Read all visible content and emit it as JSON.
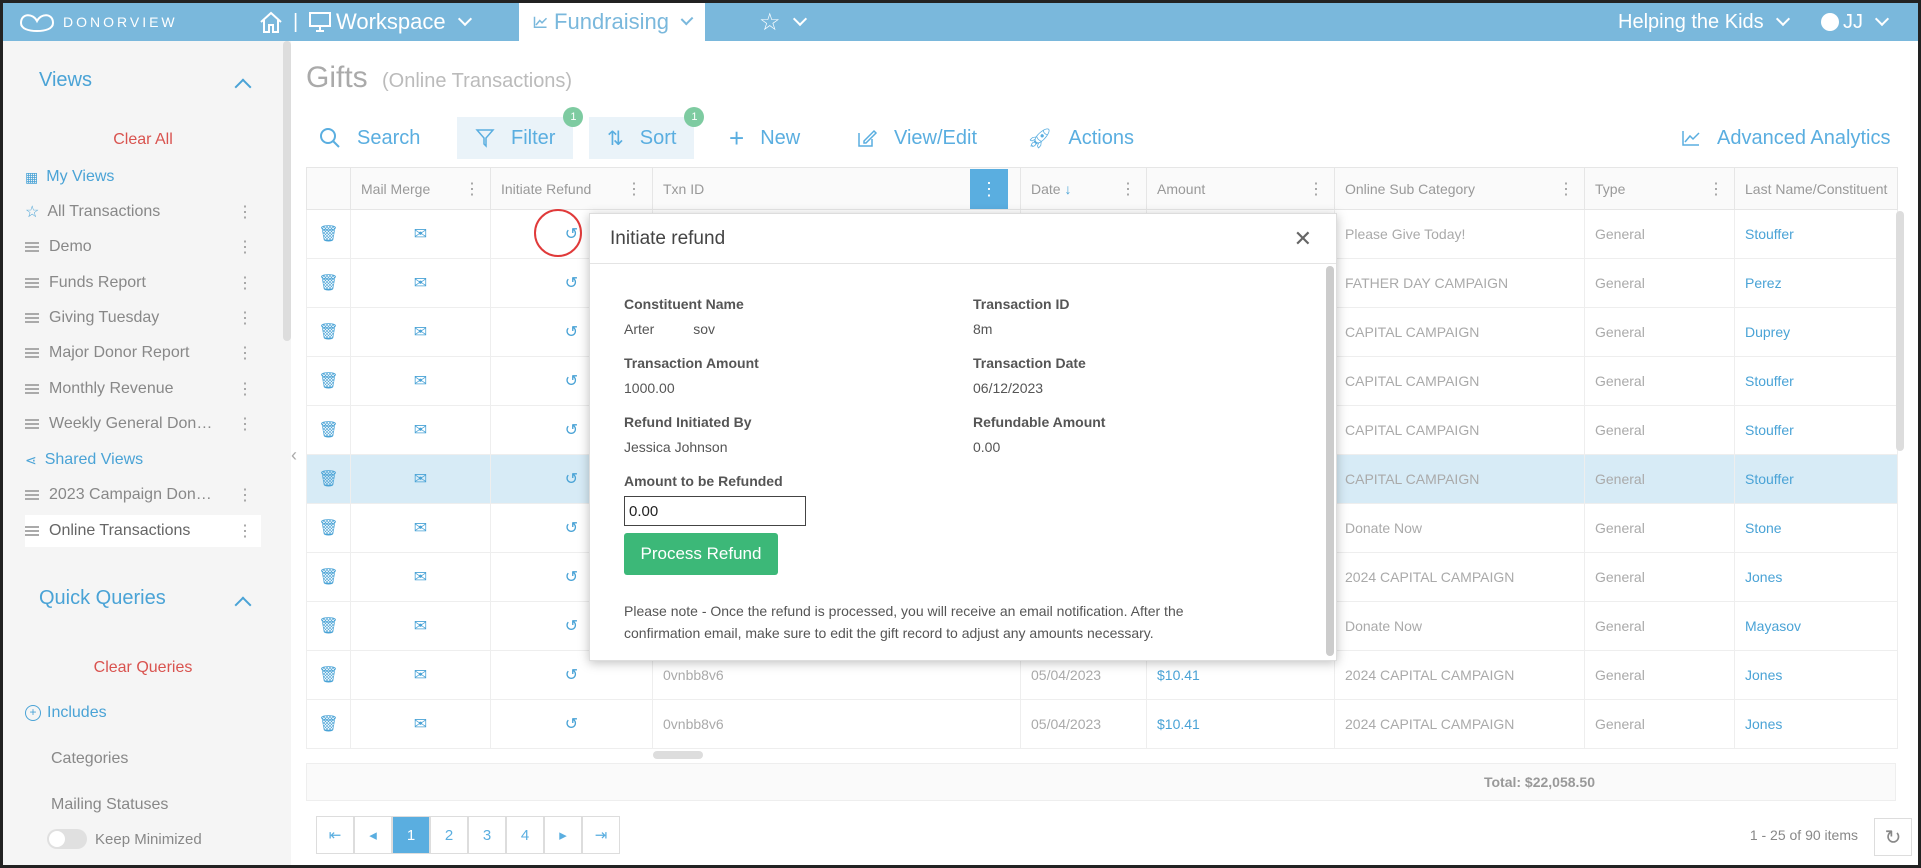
{
  "topbar": {
    "brand": "DONORVIEW",
    "workspace": "Workspace",
    "fundraising": "Fundraising",
    "org": "Helping the Kids",
    "user": "JJ",
    "separator": "|"
  },
  "sidebar": {
    "views_title": "Views",
    "clear_all": "Clear All",
    "my_views": "My Views",
    "items": [
      {
        "label": "All Transactions"
      },
      {
        "label": "Demo"
      },
      {
        "label": "Funds Report"
      },
      {
        "label": "Giving Tuesday"
      },
      {
        "label": "Major Donor Report"
      },
      {
        "label": "Monthly Revenue"
      },
      {
        "label": "Weekly General Don…"
      }
    ],
    "shared_views": "Shared Views",
    "shared_items": [
      {
        "label": "2023 Campaign Don…"
      },
      {
        "label": "Online Transactions"
      }
    ],
    "quick_queries_title": "Quick Queries",
    "clear_queries": "Clear Queries",
    "includes": "Includes",
    "categories": "Categories",
    "mailing_statuses": "Mailing Statuses",
    "keep_minimized": "Keep Minimized"
  },
  "page": {
    "title": "Gifts",
    "subtitle": "(Online Transactions)"
  },
  "toolbar": {
    "search": "Search",
    "filter": "Filter",
    "filter_count": "1",
    "sort": "Sort",
    "sort_count": "1",
    "new": "New",
    "view_edit": "View/Edit",
    "actions": "Actions",
    "advanced_analytics": "Advanced Analytics"
  },
  "grid": {
    "columns": [
      "Mail Merge",
      "Initiate Refund",
      "Txn ID",
      "Date",
      "Amount",
      "Online Sub Category",
      "Type",
      "Last Name/Constituent"
    ],
    "rows": [
      {
        "txn": "",
        "date": "",
        "amount": "",
        "sub": "Please Give Today!",
        "type": "General",
        "last": "Stouffer"
      },
      {
        "txn": "",
        "date": "",
        "amount": "",
        "sub": "FATHER DAY CAMPAIGN",
        "type": "General",
        "last": "Perez"
      },
      {
        "txn": "",
        "date": "",
        "amount": "",
        "sub": "CAPITAL CAMPAIGN",
        "type": "General",
        "last": "Duprey"
      },
      {
        "txn": "",
        "date": "",
        "amount": "",
        "sub": "CAPITAL CAMPAIGN",
        "type": "General",
        "last": "Stouffer"
      },
      {
        "txn": "",
        "date": "",
        "amount": "",
        "sub": "CAPITAL CAMPAIGN",
        "type": "General",
        "last": "Stouffer"
      },
      {
        "txn": "",
        "date": "",
        "amount": "",
        "sub": "CAPITAL CAMPAIGN",
        "type": "General",
        "last": "Stouffer"
      },
      {
        "txn": "",
        "date": "",
        "amount": "",
        "sub": "Donate Now",
        "type": "General",
        "last": "Stone"
      },
      {
        "txn": "",
        "date": "",
        "amount": "",
        "sub": "2024 CAPITAL CAMPAIGN",
        "type": "General",
        "last": "Jones"
      },
      {
        "txn": "",
        "date": "",
        "amount": "",
        "sub": "Donate Now",
        "type": "General",
        "last": "Mayasov"
      },
      {
        "txn": "0vnbb8v6",
        "date": "05/04/2023",
        "amount": "$10.41",
        "sub": "2024 CAPITAL CAMPAIGN",
        "type": "General",
        "last": "Jones"
      },
      {
        "txn": "0vnbb8v6",
        "date": "05/04/2023",
        "amount": "$10.41",
        "sub": "2024 CAPITAL CAMPAIGN",
        "type": "General",
        "last": "Jones"
      }
    ],
    "total": "Total: $22,058.50"
  },
  "pager": {
    "pages": [
      "1",
      "2",
      "3",
      "4"
    ],
    "items_count": "1 - 25 of 90 items"
  },
  "modal": {
    "title": "Initiate refund",
    "constituent_name_label": "Constituent Name",
    "constituent_name": "Arter          sov",
    "transaction_id_label": "Transaction ID",
    "transaction_id": "8m",
    "transaction_amount_label": "Transaction Amount",
    "transaction_amount": "1000.00",
    "transaction_date_label": "Transaction Date",
    "transaction_date": "06/12/2023",
    "refund_initiated_by_label": "Refund Initiated By",
    "refund_initiated_by": "Jessica Johnson",
    "refundable_amount_label": "Refundable Amount",
    "refundable_amount": "0.00",
    "amount_to_refund_label": "Amount to be Refunded",
    "amount_to_refund": "0.00",
    "process_button": "Process Refund",
    "note": "Please note - Once the refund is processed, you will receive an email notification. After the confirmation email, make sure to edit the gift record to adjust any amounts necessary."
  },
  "colors": {
    "topbar": "#7ab8dc",
    "accent": "#4aa3d6",
    "process": "#3cb878",
    "danger": "#d9534f"
  }
}
